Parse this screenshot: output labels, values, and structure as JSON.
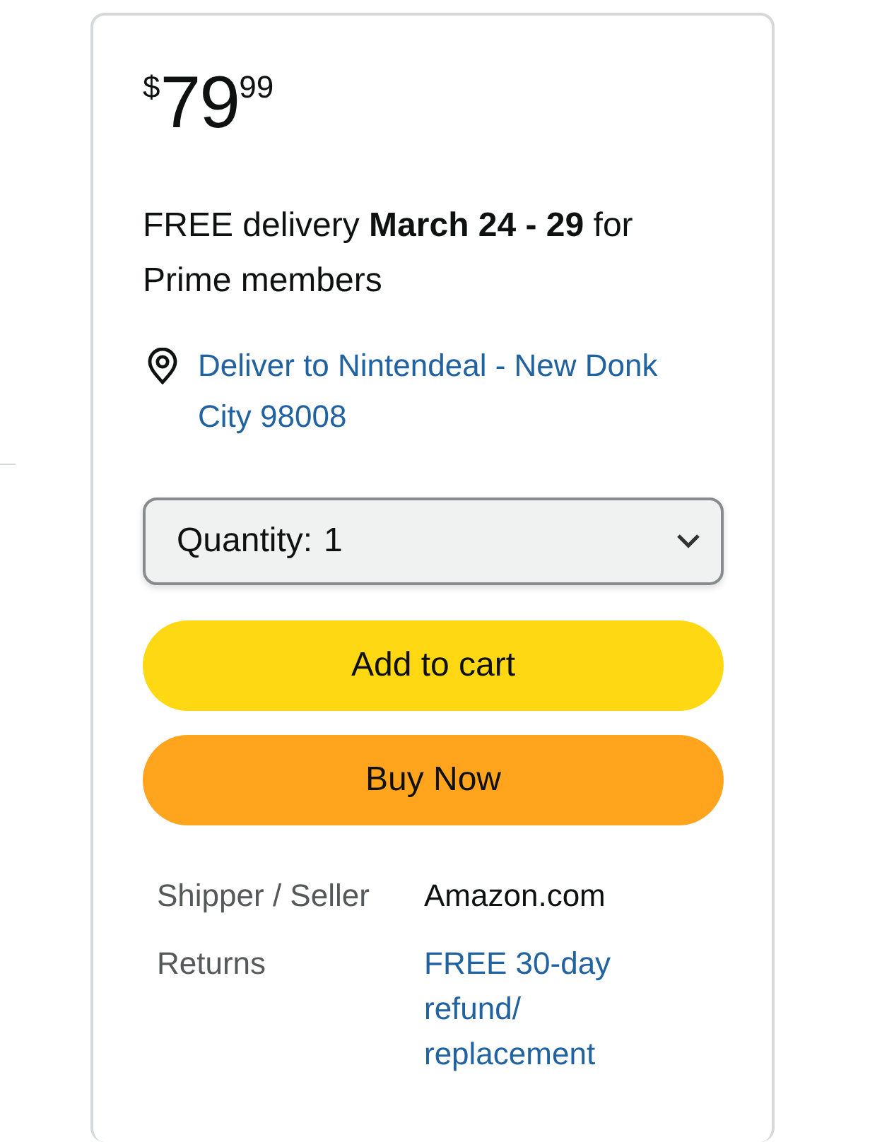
{
  "price": {
    "symbol": "$",
    "whole": "79",
    "fraction": "99"
  },
  "delivery": {
    "text": "FREE delivery **March 24 - 29** for Prime members"
  },
  "deliver_to": {
    "text": "Deliver to Nintendeal - New Donk City 98008"
  },
  "quantity": {
    "label": "Quantity:",
    "value": "1"
  },
  "buttons": [
    {
      "label": "Add to cart",
      "kind": "cart"
    },
    {
      "label": "Buy Now",
      "kind": "buy"
    }
  ],
  "details": [
    {
      "label": "Shipper / Seller",
      "value": "Amazon.com",
      "kind": "text"
    },
    {
      "label": "Returns",
      "value": "FREE 30-day refund/ replacement",
      "kind": "link"
    }
  ]
}
